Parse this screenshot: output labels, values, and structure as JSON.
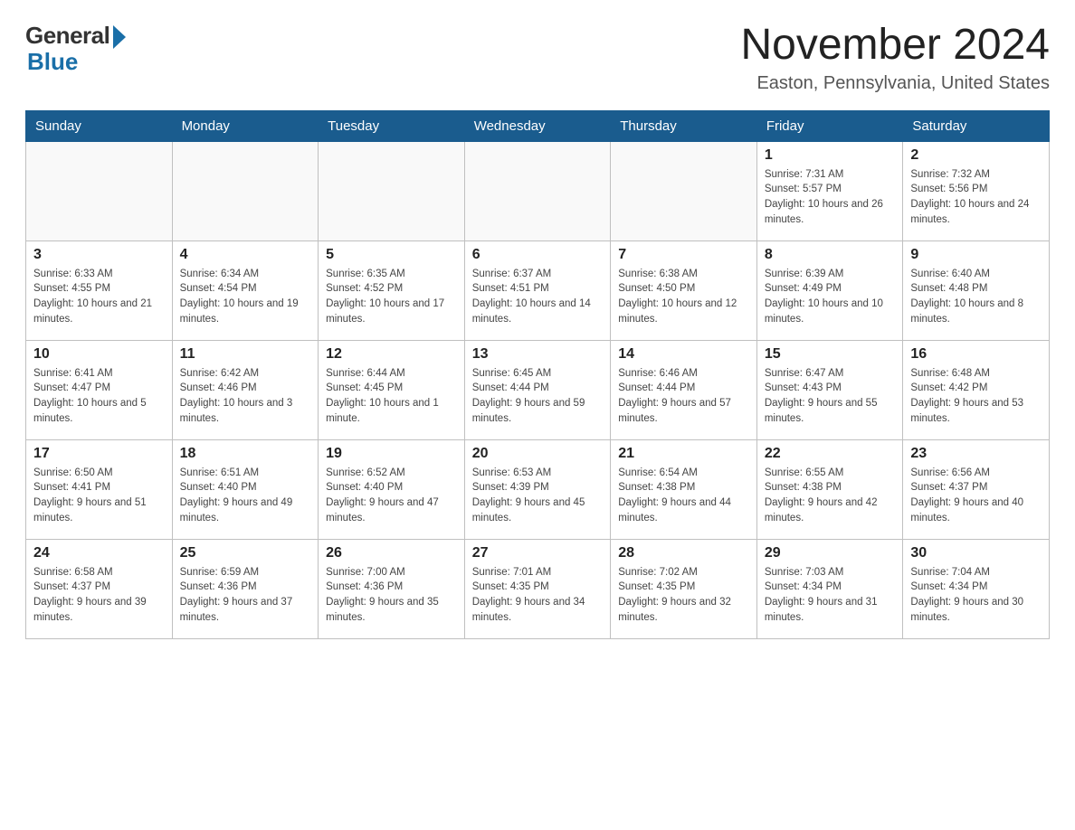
{
  "logo": {
    "general": "General",
    "blue": "Blue"
  },
  "title": "November 2024",
  "location": "Easton, Pennsylvania, United States",
  "days_of_week": [
    "Sunday",
    "Monday",
    "Tuesday",
    "Wednesday",
    "Thursday",
    "Friday",
    "Saturday"
  ],
  "weeks": [
    [
      {
        "day": "",
        "info": ""
      },
      {
        "day": "",
        "info": ""
      },
      {
        "day": "",
        "info": ""
      },
      {
        "day": "",
        "info": ""
      },
      {
        "day": "",
        "info": ""
      },
      {
        "day": "1",
        "info": "Sunrise: 7:31 AM\nSunset: 5:57 PM\nDaylight: 10 hours and 26 minutes."
      },
      {
        "day": "2",
        "info": "Sunrise: 7:32 AM\nSunset: 5:56 PM\nDaylight: 10 hours and 24 minutes."
      }
    ],
    [
      {
        "day": "3",
        "info": "Sunrise: 6:33 AM\nSunset: 4:55 PM\nDaylight: 10 hours and 21 minutes."
      },
      {
        "day": "4",
        "info": "Sunrise: 6:34 AM\nSunset: 4:54 PM\nDaylight: 10 hours and 19 minutes."
      },
      {
        "day": "5",
        "info": "Sunrise: 6:35 AM\nSunset: 4:52 PM\nDaylight: 10 hours and 17 minutes."
      },
      {
        "day": "6",
        "info": "Sunrise: 6:37 AM\nSunset: 4:51 PM\nDaylight: 10 hours and 14 minutes."
      },
      {
        "day": "7",
        "info": "Sunrise: 6:38 AM\nSunset: 4:50 PM\nDaylight: 10 hours and 12 minutes."
      },
      {
        "day": "8",
        "info": "Sunrise: 6:39 AM\nSunset: 4:49 PM\nDaylight: 10 hours and 10 minutes."
      },
      {
        "day": "9",
        "info": "Sunrise: 6:40 AM\nSunset: 4:48 PM\nDaylight: 10 hours and 8 minutes."
      }
    ],
    [
      {
        "day": "10",
        "info": "Sunrise: 6:41 AM\nSunset: 4:47 PM\nDaylight: 10 hours and 5 minutes."
      },
      {
        "day": "11",
        "info": "Sunrise: 6:42 AM\nSunset: 4:46 PM\nDaylight: 10 hours and 3 minutes."
      },
      {
        "day": "12",
        "info": "Sunrise: 6:44 AM\nSunset: 4:45 PM\nDaylight: 10 hours and 1 minute."
      },
      {
        "day": "13",
        "info": "Sunrise: 6:45 AM\nSunset: 4:44 PM\nDaylight: 9 hours and 59 minutes."
      },
      {
        "day": "14",
        "info": "Sunrise: 6:46 AM\nSunset: 4:44 PM\nDaylight: 9 hours and 57 minutes."
      },
      {
        "day": "15",
        "info": "Sunrise: 6:47 AM\nSunset: 4:43 PM\nDaylight: 9 hours and 55 minutes."
      },
      {
        "day": "16",
        "info": "Sunrise: 6:48 AM\nSunset: 4:42 PM\nDaylight: 9 hours and 53 minutes."
      }
    ],
    [
      {
        "day": "17",
        "info": "Sunrise: 6:50 AM\nSunset: 4:41 PM\nDaylight: 9 hours and 51 minutes."
      },
      {
        "day": "18",
        "info": "Sunrise: 6:51 AM\nSunset: 4:40 PM\nDaylight: 9 hours and 49 minutes."
      },
      {
        "day": "19",
        "info": "Sunrise: 6:52 AM\nSunset: 4:40 PM\nDaylight: 9 hours and 47 minutes."
      },
      {
        "day": "20",
        "info": "Sunrise: 6:53 AM\nSunset: 4:39 PM\nDaylight: 9 hours and 45 minutes."
      },
      {
        "day": "21",
        "info": "Sunrise: 6:54 AM\nSunset: 4:38 PM\nDaylight: 9 hours and 44 minutes."
      },
      {
        "day": "22",
        "info": "Sunrise: 6:55 AM\nSunset: 4:38 PM\nDaylight: 9 hours and 42 minutes."
      },
      {
        "day": "23",
        "info": "Sunrise: 6:56 AM\nSunset: 4:37 PM\nDaylight: 9 hours and 40 minutes."
      }
    ],
    [
      {
        "day": "24",
        "info": "Sunrise: 6:58 AM\nSunset: 4:37 PM\nDaylight: 9 hours and 39 minutes."
      },
      {
        "day": "25",
        "info": "Sunrise: 6:59 AM\nSunset: 4:36 PM\nDaylight: 9 hours and 37 minutes."
      },
      {
        "day": "26",
        "info": "Sunrise: 7:00 AM\nSunset: 4:36 PM\nDaylight: 9 hours and 35 minutes."
      },
      {
        "day": "27",
        "info": "Sunrise: 7:01 AM\nSunset: 4:35 PM\nDaylight: 9 hours and 34 minutes."
      },
      {
        "day": "28",
        "info": "Sunrise: 7:02 AM\nSunset: 4:35 PM\nDaylight: 9 hours and 32 minutes."
      },
      {
        "day": "29",
        "info": "Sunrise: 7:03 AM\nSunset: 4:34 PM\nDaylight: 9 hours and 31 minutes."
      },
      {
        "day": "30",
        "info": "Sunrise: 7:04 AM\nSunset: 4:34 PM\nDaylight: 9 hours and 30 minutes."
      }
    ]
  ]
}
